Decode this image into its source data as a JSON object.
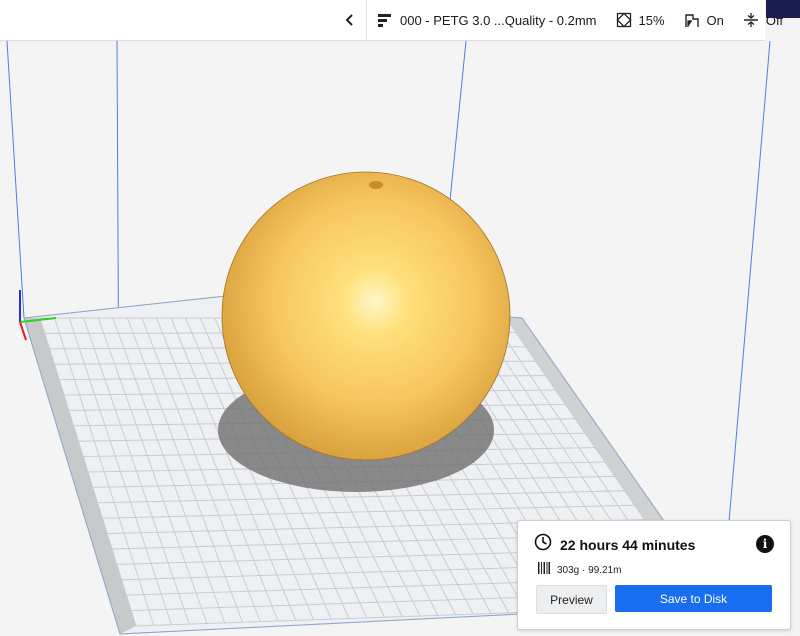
{
  "print_settings": {
    "profile_label": "000 - PETG 3.0 ...Quality - 0.2mm",
    "infill_label": "15%",
    "support_label": "On",
    "adhesion_label": "Off",
    "icons": {
      "profile": "print-profile-icon",
      "infill": "infill-icon",
      "support": "support-icon",
      "adhesion": "adhesion-icon",
      "edit": "pencil-icon",
      "collapse": "chevron-left-icon"
    }
  },
  "print_summary": {
    "time_label": "22 hours 44 minutes",
    "material_label": "303g · 99.21m",
    "preview_label": "Preview",
    "save_label": "Save to Disk"
  },
  "colors": {
    "model": "#f6c55f",
    "accent": "#196ef0",
    "build_plate": "#eef0f3",
    "grid_line": "#c9ccd0",
    "volume_edge": "#4a82d8"
  }
}
